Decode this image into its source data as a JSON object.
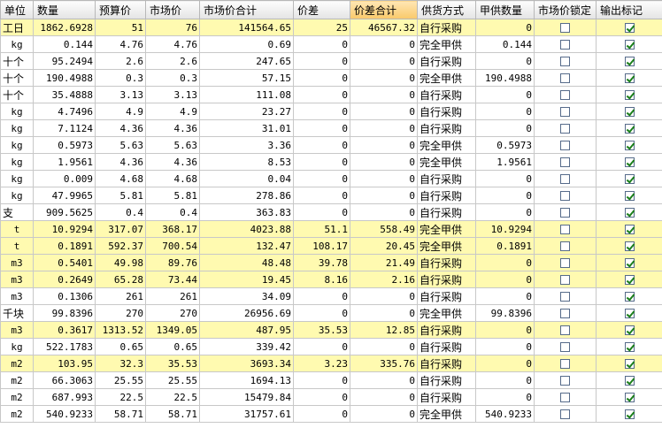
{
  "headers": [
    "单位",
    "数量",
    "预算价",
    "市场价",
    "市场价合计",
    "价差",
    "价差合计",
    "供货方式",
    "甲供数量",
    "市场价锁定",
    "输出标记"
  ],
  "rows": [
    {
      "unit": "工日",
      "qty": "1862.6928",
      "budget": "51",
      "market": "76",
      "market_total": "141564.65",
      "diff": "25",
      "diff_total": "46567.32",
      "supply": "自行采购",
      "jia_qty": "0",
      "locked": false,
      "output": true,
      "hl": true
    },
    {
      "unit": "kg",
      "qty": "0.144",
      "budget": "4.76",
      "market": "4.76",
      "market_total": "0.69",
      "diff": "0",
      "diff_total": "0",
      "supply": "完全甲供",
      "jia_qty": "0.144",
      "locked": false,
      "output": true,
      "hl": false
    },
    {
      "unit": "十个",
      "qty": "95.2494",
      "budget": "2.6",
      "market": "2.6",
      "market_total": "247.65",
      "diff": "0",
      "diff_total": "0",
      "supply": "自行采购",
      "jia_qty": "0",
      "locked": false,
      "output": true,
      "hl": false
    },
    {
      "unit": "十个",
      "qty": "190.4988",
      "budget": "0.3",
      "market": "0.3",
      "market_total": "57.15",
      "diff": "0",
      "diff_total": "0",
      "supply": "完全甲供",
      "jia_qty": "190.4988",
      "locked": false,
      "output": true,
      "hl": false
    },
    {
      "unit": "十个",
      "qty": "35.4888",
      "budget": "3.13",
      "market": "3.13",
      "market_total": "111.08",
      "diff": "0",
      "diff_total": "0",
      "supply": "自行采购",
      "jia_qty": "0",
      "locked": false,
      "output": true,
      "hl": false
    },
    {
      "unit": "kg",
      "qty": "4.7496",
      "budget": "4.9",
      "market": "4.9",
      "market_total": "23.27",
      "diff": "0",
      "diff_total": "0",
      "supply": "自行采购",
      "jia_qty": "0",
      "locked": false,
      "output": true,
      "hl": false
    },
    {
      "unit": "kg",
      "qty": "7.1124",
      "budget": "4.36",
      "market": "4.36",
      "market_total": "31.01",
      "diff": "0",
      "diff_total": "0",
      "supply": "自行采购",
      "jia_qty": "0",
      "locked": false,
      "output": true,
      "hl": false
    },
    {
      "unit": "kg",
      "qty": "0.5973",
      "budget": "5.63",
      "market": "5.63",
      "market_total": "3.36",
      "diff": "0",
      "diff_total": "0",
      "supply": "完全甲供",
      "jia_qty": "0.5973",
      "locked": false,
      "output": true,
      "hl": false
    },
    {
      "unit": "kg",
      "qty": "1.9561",
      "budget": "4.36",
      "market": "4.36",
      "market_total": "8.53",
      "diff": "0",
      "diff_total": "0",
      "supply": "完全甲供",
      "jia_qty": "1.9561",
      "locked": false,
      "output": true,
      "hl": false
    },
    {
      "unit": "kg",
      "qty": "0.009",
      "budget": "4.68",
      "market": "4.68",
      "market_total": "0.04",
      "diff": "0",
      "diff_total": "0",
      "supply": "自行采购",
      "jia_qty": "0",
      "locked": false,
      "output": true,
      "hl": false
    },
    {
      "unit": "kg",
      "qty": "47.9965",
      "budget": "5.81",
      "market": "5.81",
      "market_total": "278.86",
      "diff": "0",
      "diff_total": "0",
      "supply": "自行采购",
      "jia_qty": "0",
      "locked": false,
      "output": true,
      "hl": false
    },
    {
      "unit": "支",
      "qty": "909.5625",
      "budget": "0.4",
      "market": "0.4",
      "market_total": "363.83",
      "diff": "0",
      "diff_total": "0",
      "supply": "自行采购",
      "jia_qty": "0",
      "locked": false,
      "output": true,
      "hl": false
    },
    {
      "unit": "t",
      "qty": "10.9294",
      "budget": "317.07",
      "market": "368.17",
      "market_total": "4023.88",
      "diff": "51.1",
      "diff_total": "558.49",
      "supply": "完全甲供",
      "jia_qty": "10.9294",
      "locked": false,
      "output": true,
      "hl": true
    },
    {
      "unit": "t",
      "qty": "0.1891",
      "budget": "592.37",
      "market": "700.54",
      "market_total": "132.47",
      "diff": "108.17",
      "diff_total": "20.45",
      "supply": "完全甲供",
      "jia_qty": "0.1891",
      "locked": false,
      "output": true,
      "hl": true
    },
    {
      "unit": "m3",
      "qty": "0.5401",
      "budget": "49.98",
      "market": "89.76",
      "market_total": "48.48",
      "diff": "39.78",
      "diff_total": "21.49",
      "supply": "自行采购",
      "jia_qty": "0",
      "locked": false,
      "output": true,
      "hl": true
    },
    {
      "unit": "m3",
      "qty": "0.2649",
      "budget": "65.28",
      "market": "73.44",
      "market_total": "19.45",
      "diff": "8.16",
      "diff_total": "2.16",
      "supply": "自行采购",
      "jia_qty": "0",
      "locked": false,
      "output": true,
      "hl": true
    },
    {
      "unit": "m3",
      "qty": "0.1306",
      "budget": "261",
      "market": "261",
      "market_total": "34.09",
      "diff": "0",
      "diff_total": "0",
      "supply": "自行采购",
      "jia_qty": "0",
      "locked": false,
      "output": true,
      "hl": false
    },
    {
      "unit": "千块",
      "qty": "99.8396",
      "budget": "270",
      "market": "270",
      "market_total": "26956.69",
      "diff": "0",
      "diff_total": "0",
      "supply": "完全甲供",
      "jia_qty": "99.8396",
      "locked": false,
      "output": true,
      "hl": false
    },
    {
      "unit": "m3",
      "qty": "0.3617",
      "budget": "1313.52",
      "market": "1349.05",
      "market_total": "487.95",
      "diff": "35.53",
      "diff_total": "12.85",
      "supply": "自行采购",
      "jia_qty": "0",
      "locked": false,
      "output": true,
      "hl": true
    },
    {
      "unit": "kg",
      "qty": "522.1783",
      "budget": "0.65",
      "market": "0.65",
      "market_total": "339.42",
      "diff": "0",
      "diff_total": "0",
      "supply": "自行采购",
      "jia_qty": "0",
      "locked": false,
      "output": true,
      "hl": false
    },
    {
      "unit": "m2",
      "qty": "103.95",
      "budget": "32.3",
      "market": "35.53",
      "market_total": "3693.34",
      "diff": "3.23",
      "diff_total": "335.76",
      "supply": "自行采购",
      "jia_qty": "0",
      "locked": false,
      "output": true,
      "hl": true
    },
    {
      "unit": "m2",
      "qty": "66.3063",
      "budget": "25.55",
      "market": "25.55",
      "market_total": "1694.13",
      "diff": "0",
      "diff_total": "0",
      "supply": "自行采购",
      "jia_qty": "0",
      "locked": false,
      "output": true,
      "hl": false
    },
    {
      "unit": "m2",
      "qty": "687.993",
      "budget": "22.5",
      "market": "22.5",
      "market_total": "15479.84",
      "diff": "0",
      "diff_total": "0",
      "supply": "自行采购",
      "jia_qty": "0",
      "locked": false,
      "output": true,
      "hl": false
    },
    {
      "unit": "m2",
      "qty": "540.9233",
      "budget": "58.71",
      "market": "58.71",
      "market_total": "31757.61",
      "diff": "0",
      "diff_total": "0",
      "supply": "完全甲供",
      "jia_qty": "540.9233",
      "locked": false,
      "output": true,
      "hl": false
    }
  ]
}
